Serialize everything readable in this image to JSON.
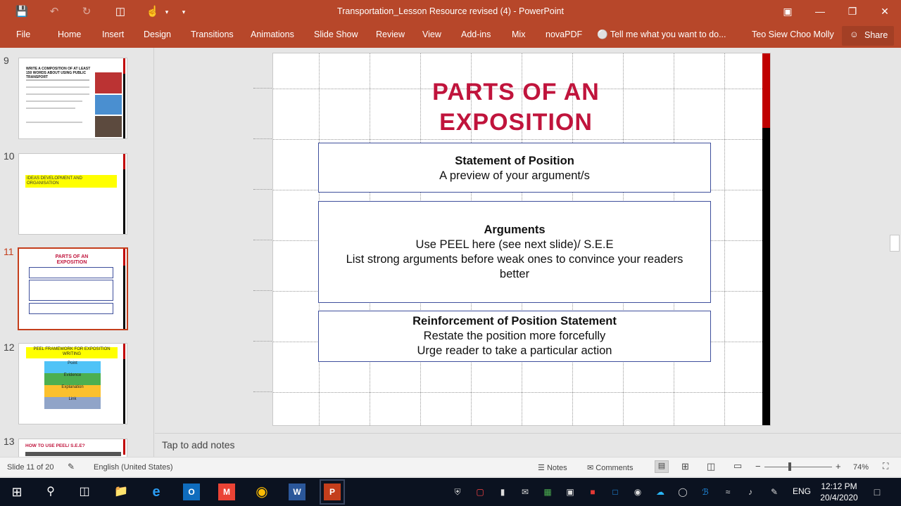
{
  "window": {
    "title": "Transportation_Lesson Resource revised (4)  -  PowerPoint",
    "qat_icons": [
      "save-icon",
      "undo-icon",
      "redo-icon",
      "start-from-beginning-icon",
      "touch-mode-icon",
      "customize-qat-icon"
    ]
  },
  "ribbon": {
    "tabs": [
      "File",
      "Home",
      "Insert",
      "Design",
      "Transitions",
      "Animations",
      "Slide Show",
      "Review",
      "View",
      "Add-ins",
      "Mix",
      "novaPDF"
    ],
    "tell_me": "Tell me what you want to do...",
    "user": "Teo Siew Choo Molly",
    "share": "Share"
  },
  "thumbnails": [
    {
      "number": "9",
      "title": "WRITE A COMPOSITION OF AT LEAST 150 WORDS ABOUT USING PUBLIC TRANSPORT"
    },
    {
      "number": "10",
      "title": "IDEAS DEVELOPMENT AND ORGANISATION"
    },
    {
      "number": "11",
      "title": "PARTS OF AN EXPOSITION",
      "active": true
    },
    {
      "number": "12",
      "title": "PEEL FRAMEWORK FOR EXPOSITION WRITING",
      "items": [
        "Point",
        "Evidence",
        "Explanation",
        "Link"
      ]
    },
    {
      "number": "13",
      "title": "HOW TO USE PEEL/ S.E.E?"
    }
  ],
  "slide": {
    "title_line1": "PARTS OF AN",
    "title_line2": "EXPOSITION",
    "box1": {
      "head": "Statement of Position",
      "line1": "A preview of your argument/s"
    },
    "box2": {
      "head": "Arguments",
      "line1": "Use PEEL here (see next slide)/ S.E.E",
      "line2": "List strong arguments before weak ones to convince your readers",
      "line3": "better"
    },
    "box3": {
      "head": "Reinforcement of Position Statement",
      "line1": "Restate the position more forcefully",
      "line2": "Urge reader to take a particular action"
    }
  },
  "notes_placeholder": "Tap to add notes",
  "status": {
    "slide_info": "Slide 11 of 20",
    "language": "English (United States)",
    "notes": "Notes",
    "comments": "Comments",
    "zoom": "74%"
  },
  "taskbar": {
    "language": "ENG",
    "time": "12:12 PM",
    "date": "20/4/2020"
  }
}
